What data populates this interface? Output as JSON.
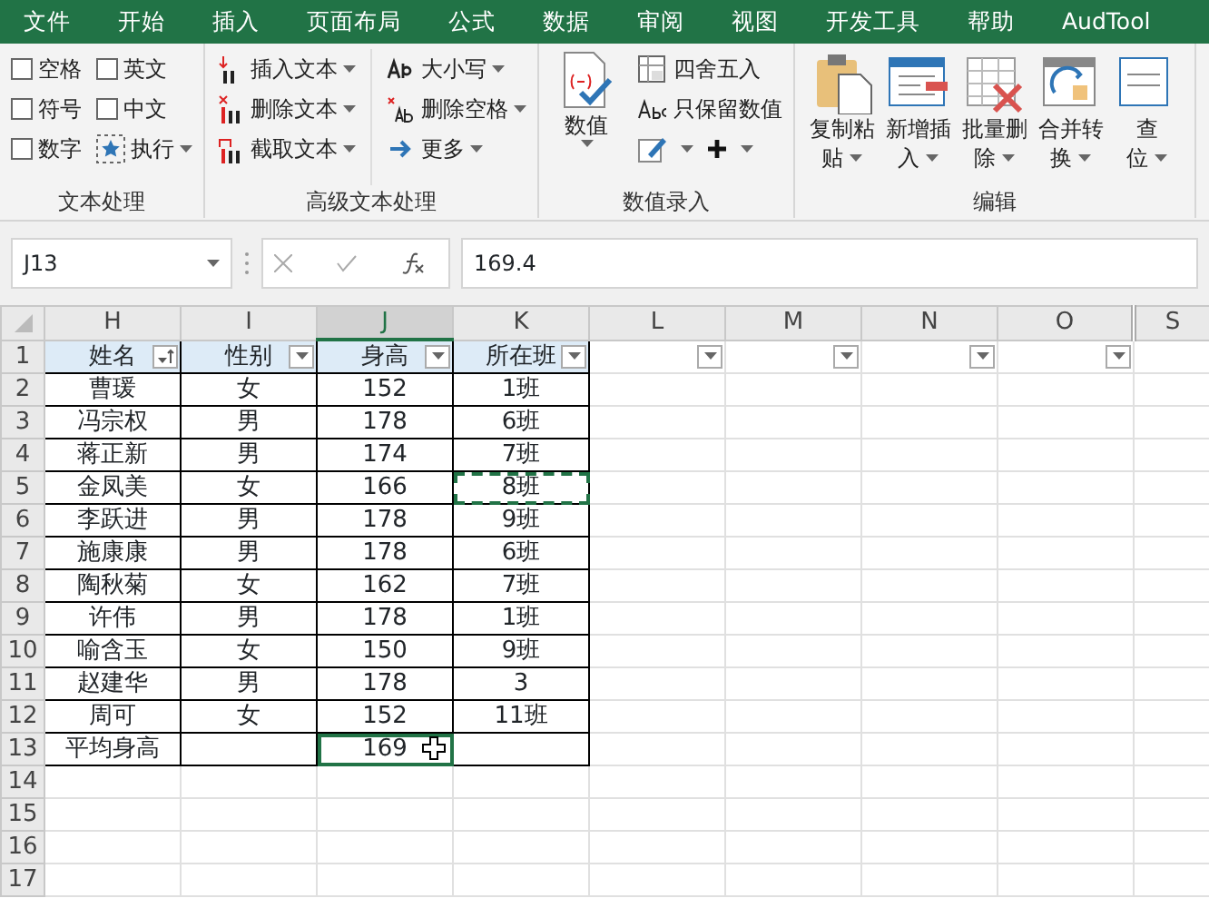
{
  "menu_tabs": [
    "文件",
    "开始",
    "插入",
    "页面布局",
    "公式",
    "数据",
    "审阅",
    "视图",
    "开发工具",
    "帮助",
    "AudTool"
  ],
  "ribbon": {
    "groups": [
      {
        "kind": "checks",
        "label": "文本处理",
        "checkboxes": [
          {
            "label": "空格",
            "checked": false
          },
          {
            "label": "英文",
            "checked": false
          },
          {
            "label": "符号",
            "checked": false
          },
          {
            "label": "中文",
            "checked": false
          },
          {
            "label": "数字",
            "checked": false
          }
        ],
        "run_button": "执行"
      },
      {
        "kind": "list",
        "label": "高级文本处理",
        "columns": [
          [
            {
              "label": "插入文本"
            },
            {
              "label": "删除文本"
            },
            {
              "label": "截取文本"
            }
          ],
          [
            {
              "label": "大小写"
            },
            {
              "label": "删除空格"
            },
            {
              "label": "更多"
            }
          ]
        ]
      },
      {
        "kind": "numeric",
        "label": "数值录入",
        "big_button": "数值",
        "items": [
          {
            "label": "四舍五入"
          },
          {
            "label": "只保留数值"
          }
        ]
      },
      {
        "kind": "big",
        "label": "编辑",
        "buttons": [
          {
            "lines": [
              "复制粘",
              "贴"
            ]
          },
          {
            "lines": [
              "新增插",
              "入"
            ]
          },
          {
            "lines": [
              "批量删",
              "除"
            ]
          },
          {
            "lines": [
              "合并转",
              "换"
            ]
          },
          {
            "lines": [
              "查",
              "位"
            ]
          }
        ]
      }
    ]
  },
  "name_box": "J13",
  "formula": "169.4",
  "columns": [
    {
      "letter": "H",
      "filter": true,
      "sorted": true,
      "selected": false
    },
    {
      "letter": "I",
      "filter": true,
      "sorted": false,
      "selected": false
    },
    {
      "letter": "J",
      "filter": true,
      "sorted": false,
      "selected": true
    },
    {
      "letter": "K",
      "filter": true,
      "sorted": false,
      "selected": false
    },
    {
      "letter": "L",
      "filter": true,
      "sorted": false,
      "selected": false
    },
    {
      "letter": "M",
      "filter": true,
      "sorted": false,
      "selected": false
    },
    {
      "letter": "N",
      "filter": true,
      "sorted": false,
      "selected": false
    },
    {
      "letter": "O",
      "filter": true,
      "sorted": false,
      "selected": false
    },
    {
      "letter": "S",
      "filter": false,
      "sorted": false,
      "selected": false
    }
  ],
  "rows": [
    {
      "number": "1",
      "header": true,
      "cells": [
        "姓名",
        "性别",
        "身高",
        "所在班"
      ]
    },
    {
      "number": "2",
      "cells": [
        "曹瑗",
        "女",
        "152",
        "1班"
      ]
    },
    {
      "number": "3",
      "cells": [
        "冯宗权",
        "男",
        "178",
        "6班"
      ]
    },
    {
      "number": "4",
      "cells": [
        "蒋正新",
        "男",
        "174",
        "7班"
      ]
    },
    {
      "number": "5",
      "cells": [
        "金凤美",
        "女",
        "166",
        "8班"
      ],
      "copied": [
        false,
        false,
        false,
        true
      ]
    },
    {
      "number": "6",
      "cells": [
        "李跃进",
        "男",
        "178",
        "9班"
      ]
    },
    {
      "number": "7",
      "cells": [
        "施康康",
        "男",
        "178",
        "6班"
      ]
    },
    {
      "number": "8",
      "cells": [
        "陶秋菊",
        "女",
        "162",
        "7班"
      ]
    },
    {
      "number": "9",
      "cells": [
        "许伟",
        "男",
        "178",
        "1班"
      ]
    },
    {
      "number": "10",
      "cells": [
        "喻含玉",
        "女",
        "150",
        "9班"
      ]
    },
    {
      "number": "11",
      "cells": [
        "赵建华",
        "男",
        "178",
        "3"
      ]
    },
    {
      "number": "12",
      "cells": [
        "周可",
        "女",
        "152",
        "11班"
      ]
    },
    {
      "number": "13",
      "cells": [
        "平均身高",
        "",
        "169",
        ""
      ],
      "active": [
        false,
        false,
        true,
        false
      ]
    },
    {
      "number": "14",
      "cells": []
    },
    {
      "number": "15",
      "cells": []
    },
    {
      "number": "16",
      "cells": []
    },
    {
      "number": "17",
      "cells": []
    }
  ]
}
